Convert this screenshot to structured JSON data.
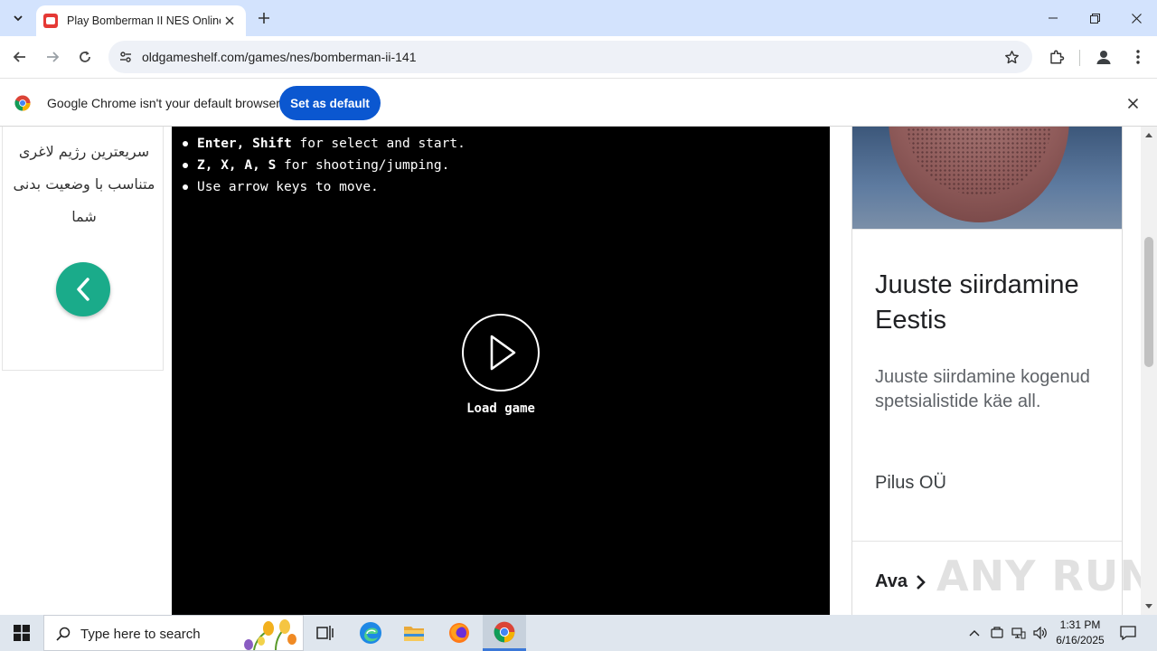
{
  "browser": {
    "tab_title": "Play Bomberman II NES Online",
    "url": "oldgameshelf.com/games/nes/bomberman-ii-141"
  },
  "infobar": {
    "message": "Google Chrome isn't your default browser",
    "set_default_label": "Set as default"
  },
  "left_ad": {
    "text": "سریعترین رژیم لاغری متناسب با وضعیت بدنی شما"
  },
  "game": {
    "controls": [
      {
        "keys": "Enter, Shift",
        "desc": " for select and start."
      },
      {
        "keys": "Z, X, A, S",
        "desc": " for shooting/jumping."
      },
      {
        "keys": "",
        "desc": "Use arrow keys to move."
      }
    ],
    "load_label": "Load game"
  },
  "right_ad": {
    "title": "Juuste siirdamine Eestis",
    "description": "Juuste siirdamine kogenud spetsialistide käe all.",
    "advertiser": "Pilus OÜ",
    "cta": "Ava"
  },
  "watermark": "ANY RUN",
  "taskbar": {
    "search_placeholder": "Type here to search",
    "time": "1:31 PM",
    "date": "6/16/2025"
  },
  "colors": {
    "tabstrip": "#d3e3fd",
    "primary_button": "#0b57d0",
    "back_button": "#1aab8a",
    "game_background": "#000000"
  }
}
